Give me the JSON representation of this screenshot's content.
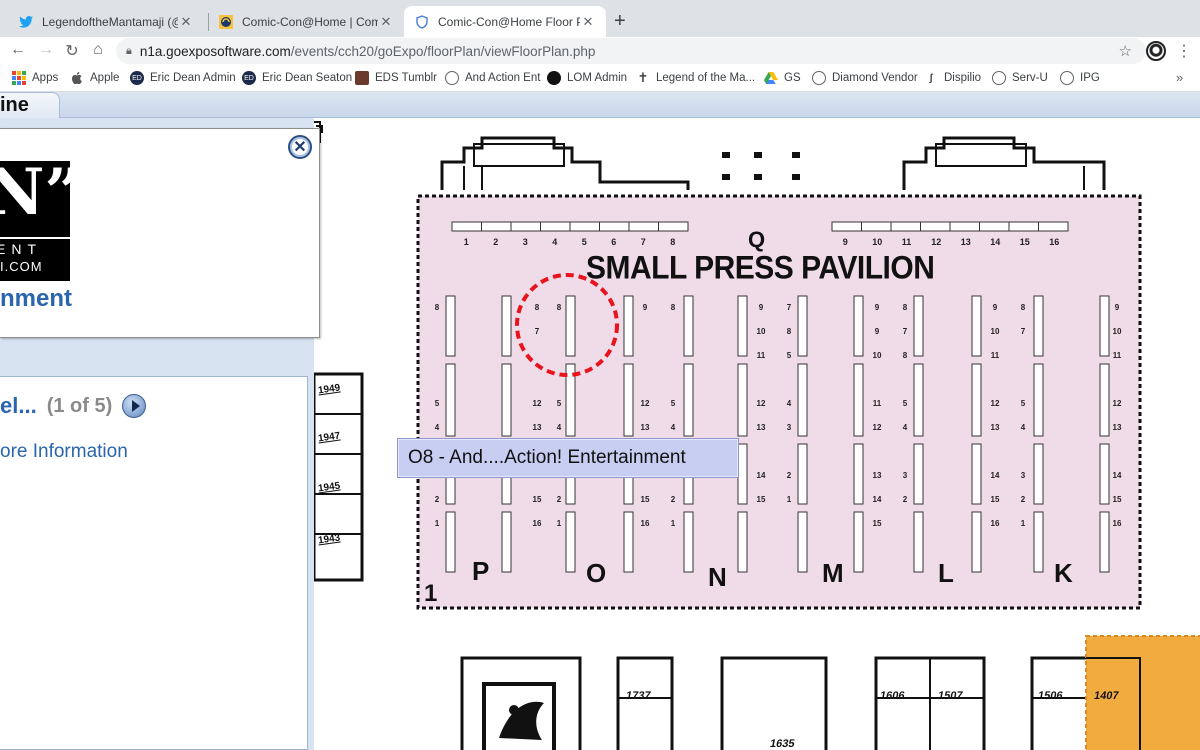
{
  "browser": {
    "tabs": [
      {
        "title": "LegendoftheMantamaji (@Man",
        "icon": "twitter-icon"
      },
      {
        "title": "Comic-Con@Home | Comic-Co",
        "icon": "comic-con-icon"
      },
      {
        "title": "Comic-Con@Home Floor Plan",
        "icon": "shield-icon",
        "active": true
      }
    ],
    "url_host": "n1a.goexposoftware.com",
    "url_path": "/events/cch20/goExpo/floorPlan/viewFloorPlan.php",
    "bookmarks": [
      "Apps",
      "Apple",
      "Eric Dean Admin",
      "Eric Dean Seaton",
      "EDS Tumblr",
      "And Action Ent",
      "LOM Admin",
      "Legend of the Ma...",
      "GS",
      "Diamond Vendor",
      "Dispilio",
      "Serv-U",
      "IPG"
    ]
  },
  "page": {
    "nav_tab_label": "ine",
    "exhibitor": {
      "logo_big": "N”",
      "logo_line1": "ENT",
      "logo_line2": "I.COM",
      "name": "nment"
    },
    "pager": {
      "title": "el...",
      "count": "(1 of 5)"
    },
    "more_info": "ore Information"
  },
  "floor_plan": {
    "q_letter": "Q",
    "pavilion_title": "SMALL PRESS PAVILION",
    "top_booths_left": [
      "1",
      "2",
      "3",
      "4",
      "5",
      "6",
      "7",
      "8"
    ],
    "top_booths_right": [
      "9",
      "10",
      "11",
      "12",
      "13",
      "14",
      "15",
      "16"
    ],
    "aisle_letters": [
      "P",
      "O",
      "N",
      "M",
      "L",
      "K"
    ],
    "hall_number": "1",
    "side_booths": [
      "1949",
      "1947",
      "1945",
      "1943"
    ],
    "bottom_booths": [
      "1737",
      "1635",
      "1606",
      "1507",
      "1506",
      "1407"
    ],
    "tooltip": "O8 - And....Action! Entertainment",
    "colors": {
      "pavilion_fill": "#f0dce8",
      "highlight_circle": "#e8131c",
      "orange_area": "#f2ab3e"
    }
  }
}
